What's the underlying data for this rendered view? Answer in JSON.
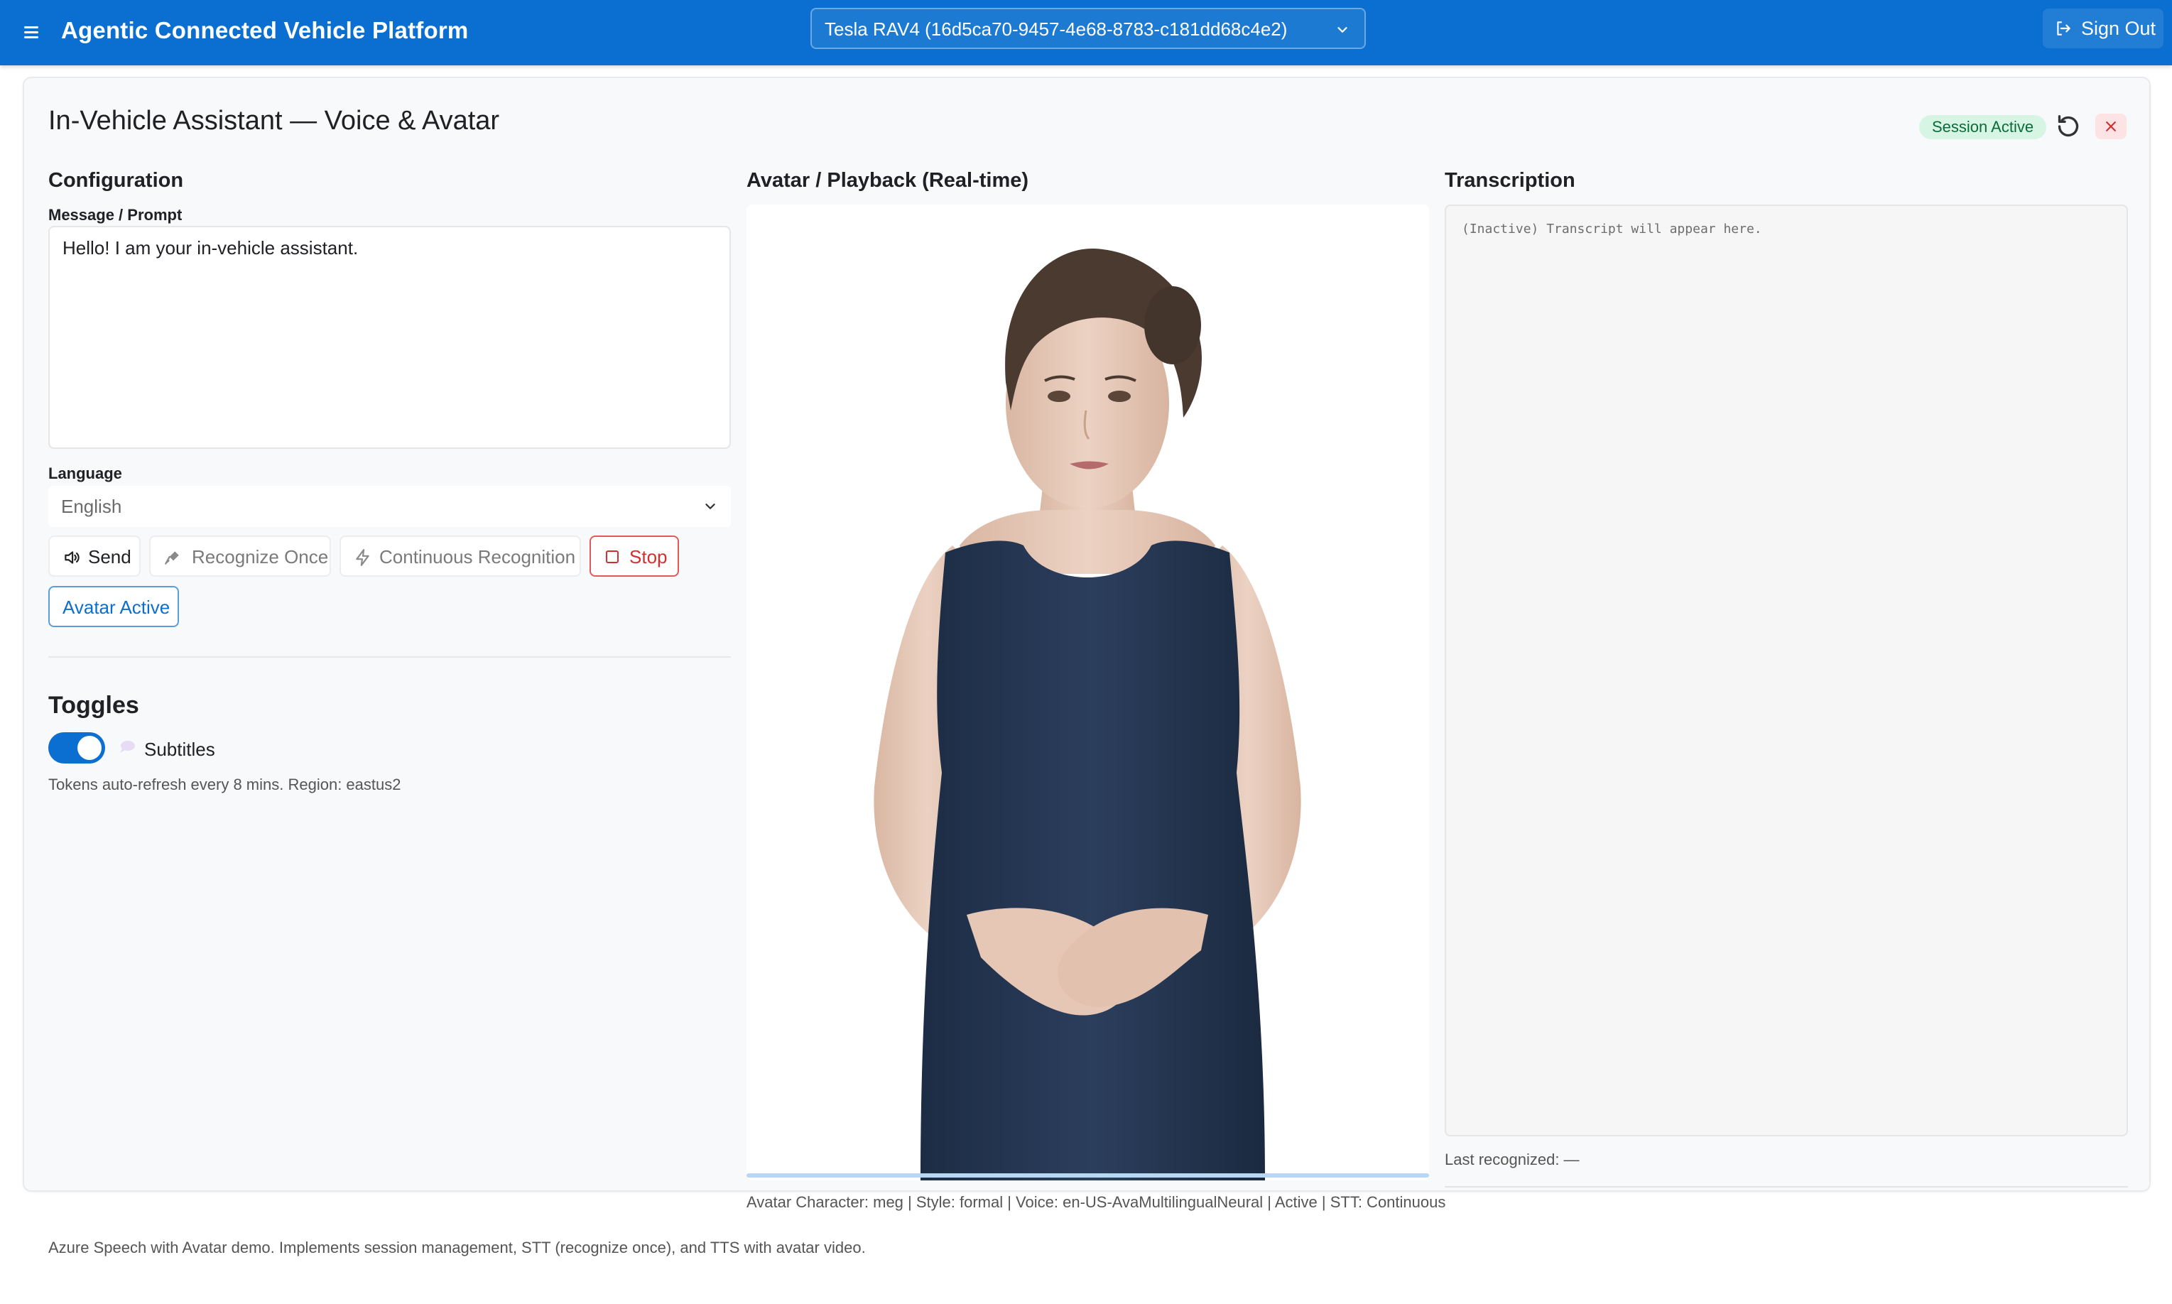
{
  "header": {
    "app_title": "Agentic Connected Vehicle Platform",
    "vehicle_selected": "Tesla RAV4 (16d5ca70-9457-4e68-8783-c181dd68c4e2)",
    "sign_out_label": "Sign Out",
    "accent_color": "#0a6fd0"
  },
  "page": {
    "title": "In-Vehicle Assistant — Voice & Avatar",
    "session_status": "Session Active"
  },
  "config": {
    "heading": "Configuration",
    "prompt_label": "Message / Prompt",
    "prompt_value": "Hello! I am your in-vehicle assistant.",
    "language_label": "Language",
    "language_value": "English",
    "buttons": {
      "send": "Send",
      "recognize_once": "Recognize Once",
      "continuous": "Continuous Recognition",
      "stop": "Stop",
      "avatar_active": "Avatar Active"
    }
  },
  "toggles": {
    "heading": "Toggles",
    "subtitles_label": "Subtitles",
    "subtitles_on": true,
    "token_note": "Tokens auto-refresh every 8 mins. Region: eastus2"
  },
  "avatar": {
    "heading": "Avatar / Playback (Real-time)",
    "status_line": "Avatar Character: meg | Style: formal | Voice: en-US-AvaMultilingualNeural | Active | STT: Continuous"
  },
  "transcription": {
    "heading": "Transcription",
    "placeholder": "(Inactive) Transcript will appear here.",
    "last_recognized": "Last recognized: —"
  },
  "footer": {
    "text": "Azure Speech with Avatar demo. Implements session management, STT (recognize once), and TTS with avatar video."
  },
  "icons": {
    "menu": "hamburger-menu-icon",
    "chevron": "chevron-down-icon",
    "sign_out": "sign-out-icon",
    "refresh": "refresh-icon",
    "close": "close-icon",
    "send": "speaker-icon",
    "recognize": "microphone-icon",
    "continuous": "lightning-icon",
    "stop": "stop-square-icon",
    "subtitles": "speech-bubble-icon"
  }
}
